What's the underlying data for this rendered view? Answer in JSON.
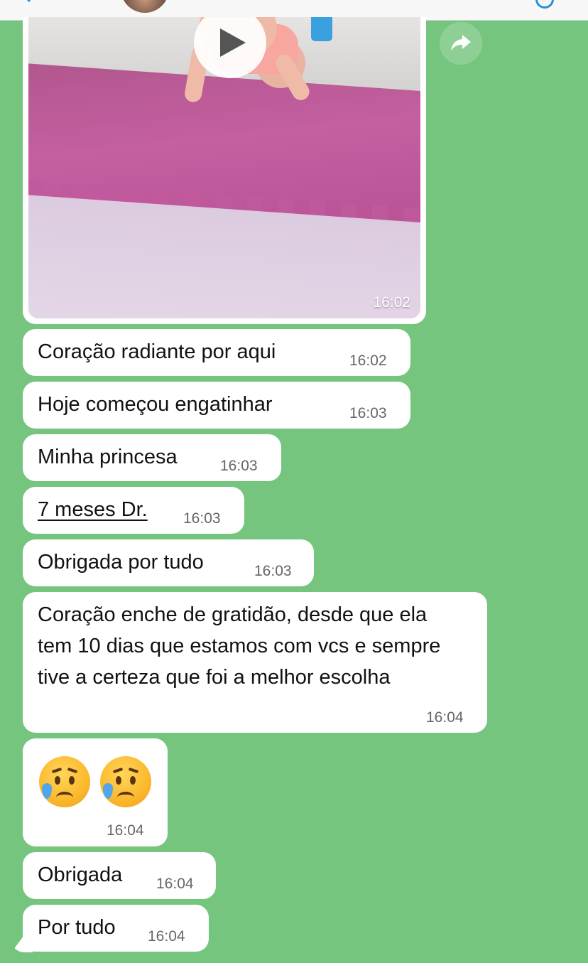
{
  "chat": {
    "video_message": {
      "time": "16:02"
    },
    "messages": [
      {
        "text": "Coração radiante por aqui",
        "time": "16:02"
      },
      {
        "text": "Hoje começou engatinhar",
        "time": "16:03"
      },
      {
        "text": "Minha princesa",
        "time": "16:03"
      },
      {
        "text": "7 meses Dr.",
        "time": "16:03"
      },
      {
        "text": "Obrigada por tudo",
        "time": "16:03"
      },
      {
        "text": "Coração enche de gratidão, desde que ela tem 10 dias que estamos com vcs e sempre tive a certeza que foi a melhor escolha",
        "time": "16:04"
      },
      {
        "emoji": "😢😢",
        "time": "16:04"
      },
      {
        "text": "Obrigada",
        "time": "16:04"
      },
      {
        "text": "Por tudo",
        "time": "16:04"
      }
    ]
  },
  "icons": {
    "back": "back-arrow-icon",
    "play": "play-icon",
    "forward": "forward-share-icon",
    "call": "call-icon",
    "crying_face": "crying-face-icon"
  },
  "colors": {
    "chat_background": "#76c57e",
    "bubble": "#ffffff",
    "header": "#f7f7f7",
    "accent": "#2a8fd6"
  }
}
